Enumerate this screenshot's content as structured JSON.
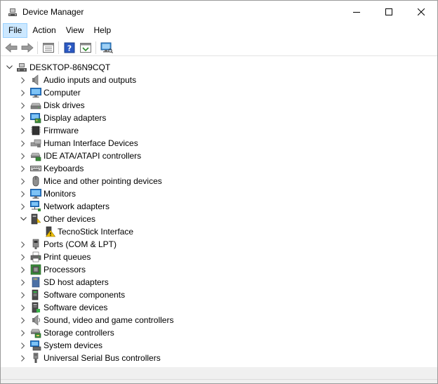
{
  "window": {
    "title": "Device Manager"
  },
  "menu": {
    "file": "File",
    "action": "Action",
    "view": "View",
    "help": "Help"
  },
  "toolbar": {
    "buttons": [
      "back-icon",
      "forward-icon",
      "properties-pane-icon",
      "help-icon",
      "update-driver-icon",
      "scan-hardware-icon"
    ]
  },
  "tree": {
    "root": "DESKTOP-86N9CQT",
    "categories": [
      {
        "label": "Audio inputs and outputs",
        "icon": "speaker-icon",
        "expanded": false
      },
      {
        "label": "Computer",
        "icon": "monitor-icon",
        "expanded": false
      },
      {
        "label": "Disk drives",
        "icon": "disk-drive-icon",
        "expanded": false
      },
      {
        "label": "Display adapters",
        "icon": "display-adapter-icon",
        "expanded": false
      },
      {
        "label": "Firmware",
        "icon": "chip-icon",
        "expanded": false
      },
      {
        "label": "Human Interface Devices",
        "icon": "hid-icon",
        "expanded": false
      },
      {
        "label": "IDE ATA/ATAPI controllers",
        "icon": "ide-controller-icon",
        "expanded": false
      },
      {
        "label": "Keyboards",
        "icon": "keyboard-icon",
        "expanded": false
      },
      {
        "label": "Mice and other pointing devices",
        "icon": "mouse-icon",
        "expanded": false
      },
      {
        "label": "Monitors",
        "icon": "monitor-icon",
        "expanded": false
      },
      {
        "label": "Network adapters",
        "icon": "network-icon",
        "expanded": false
      },
      {
        "label": "Other devices",
        "icon": "unknown-device-icon",
        "expanded": true,
        "children": [
          {
            "label": "TecnoStick Interface",
            "icon": "warning-device-icon"
          }
        ]
      },
      {
        "label": "Ports (COM & LPT)",
        "icon": "port-icon",
        "expanded": false
      },
      {
        "label": "Print queues",
        "icon": "printer-icon",
        "expanded": false
      },
      {
        "label": "Processors",
        "icon": "processor-icon",
        "expanded": false
      },
      {
        "label": "SD host adapters",
        "icon": "sd-card-icon",
        "expanded": false
      },
      {
        "label": "Software components",
        "icon": "software-component-icon",
        "expanded": false
      },
      {
        "label": "Software devices",
        "icon": "software-device-icon",
        "expanded": false
      },
      {
        "label": "Sound, video and game controllers",
        "icon": "sound-icon",
        "expanded": false
      },
      {
        "label": "Storage controllers",
        "icon": "storage-controller-icon",
        "expanded": false
      },
      {
        "label": "System devices",
        "icon": "system-device-icon",
        "expanded": false
      },
      {
        "label": "Universal Serial Bus controllers",
        "icon": "usb-icon",
        "expanded": false
      }
    ]
  },
  "colors": {
    "menu_highlight": "#cce8ff",
    "accent": "#1e78c8"
  }
}
